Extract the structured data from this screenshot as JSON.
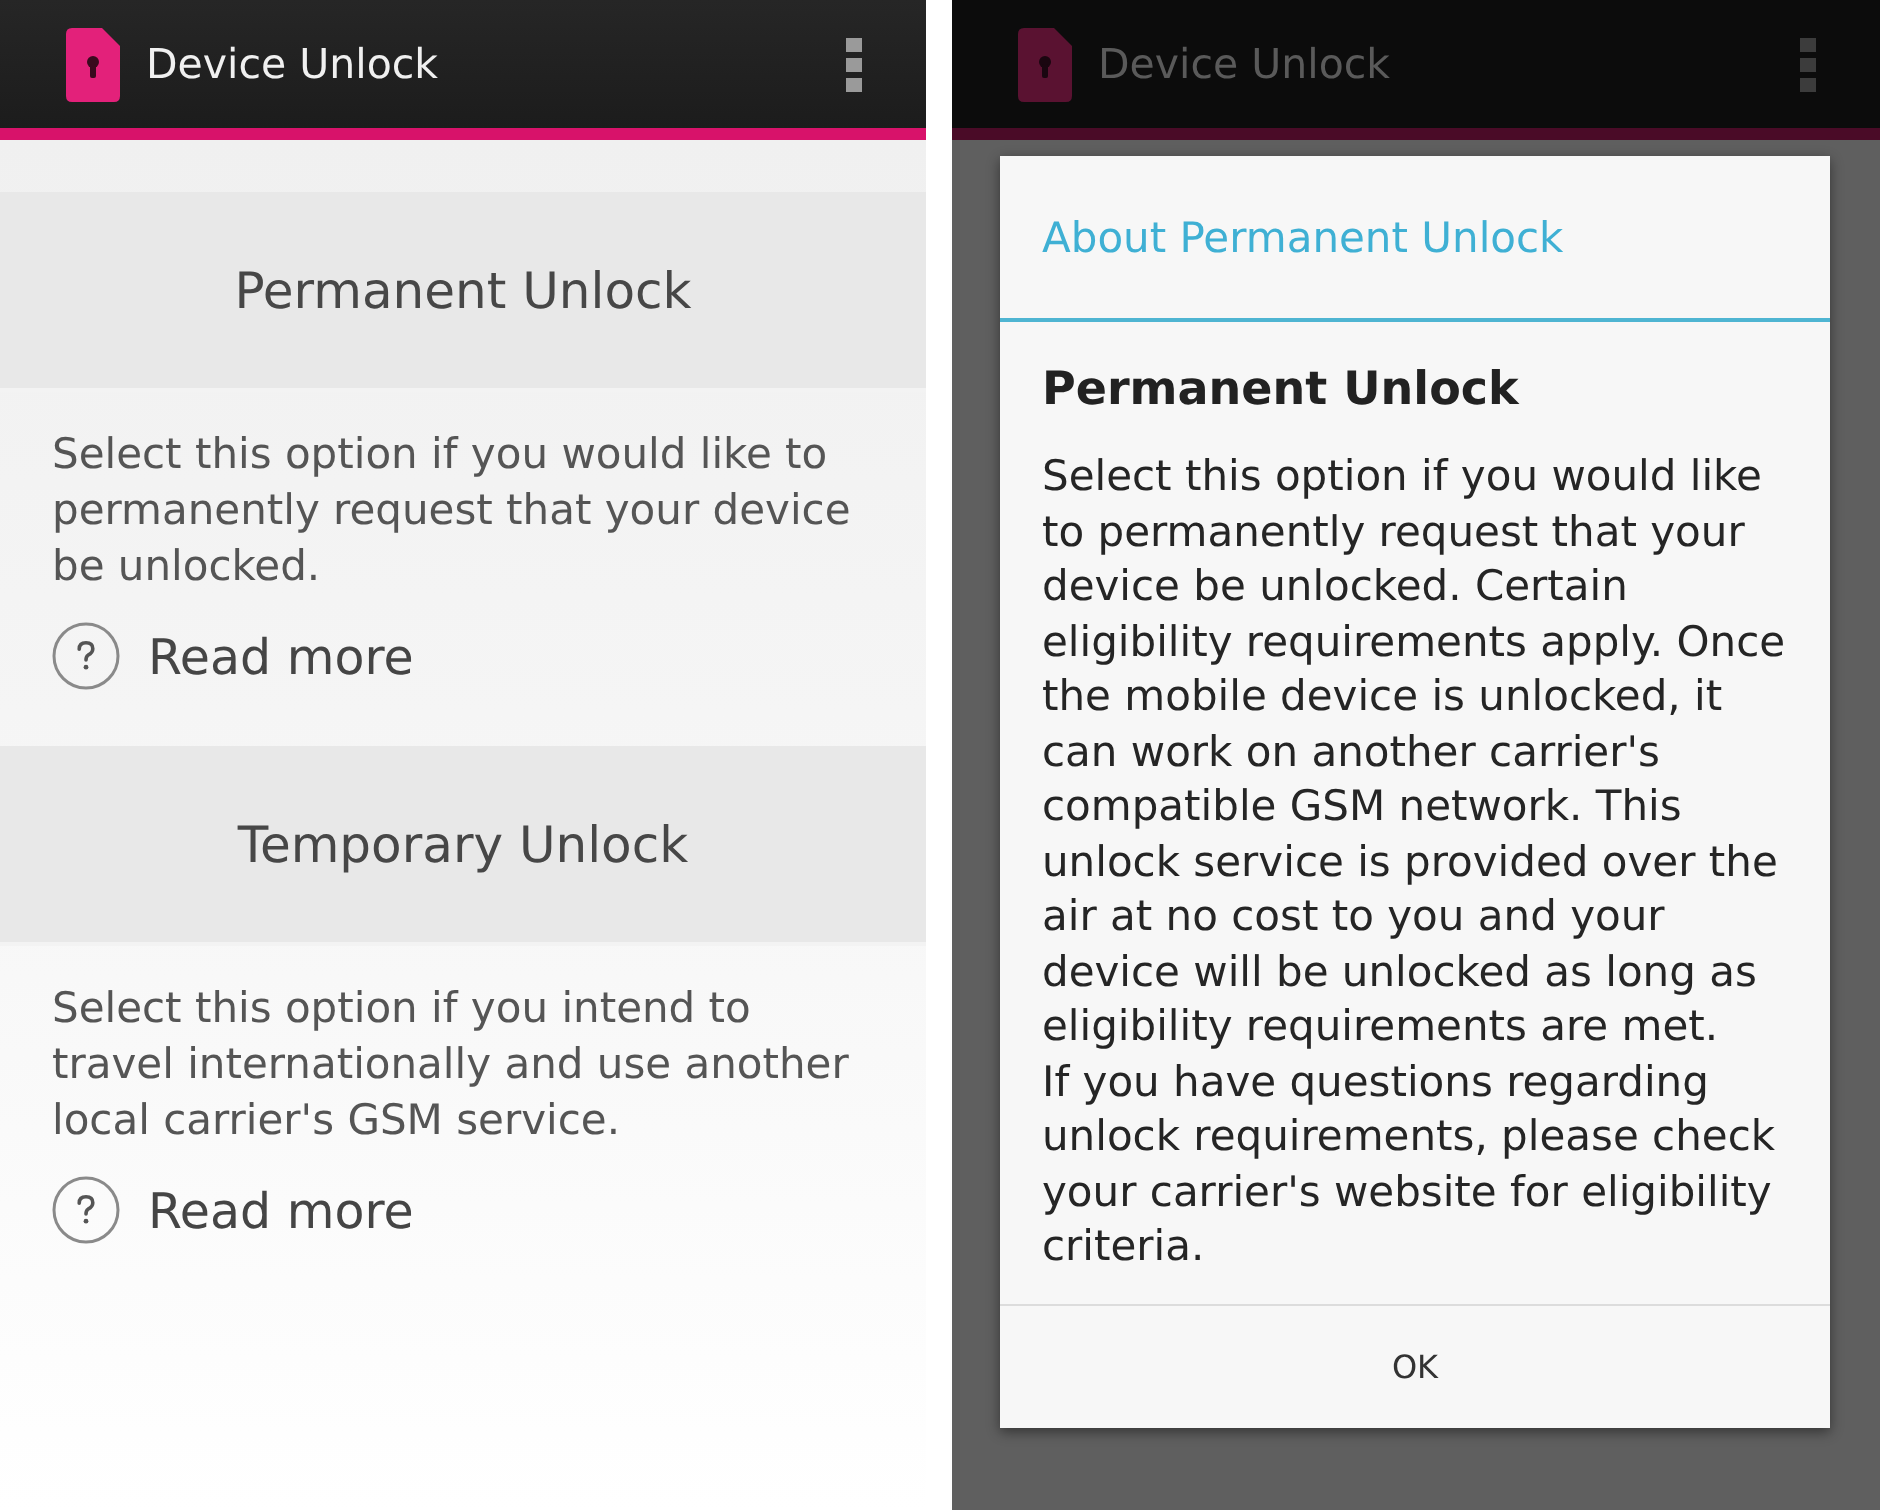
{
  "screens": [
    {
      "dimmed": false,
      "app_bar": {
        "title": "Device Unlock"
      },
      "options": [
        {
          "title": "Permanent Unlock",
          "description": "Select this option if you would like to permanently request that your device be unlocked.",
          "link": "Read more"
        },
        {
          "title": "Temporary Unlock",
          "description": "Select this option if you intend to travel internationally and use another local carrier's GSM service.",
          "link": "Read more"
        }
      ]
    },
    {
      "dimmed": true,
      "app_bar": {
        "title": "Device Unlock"
      },
      "dialog": {
        "title": "About Permanent Unlock",
        "heading": "Permanent Unlock",
        "paragraphs": [
          "Select this option if you would like to permanently request that your device be unlocked. Certain eligibility requirements apply. Once the mobile device is unlocked, it can work on another carrier's compatible GSM network. This unlock service is provided over the air at no cost to you and your device will be unlocked as long as eligibility requirements are met.",
          "If you have questions regarding unlock requirements, please check your carrier's website for eligibility criteria."
        ],
        "buttons": [
          "OK"
        ]
      }
    }
  ]
}
